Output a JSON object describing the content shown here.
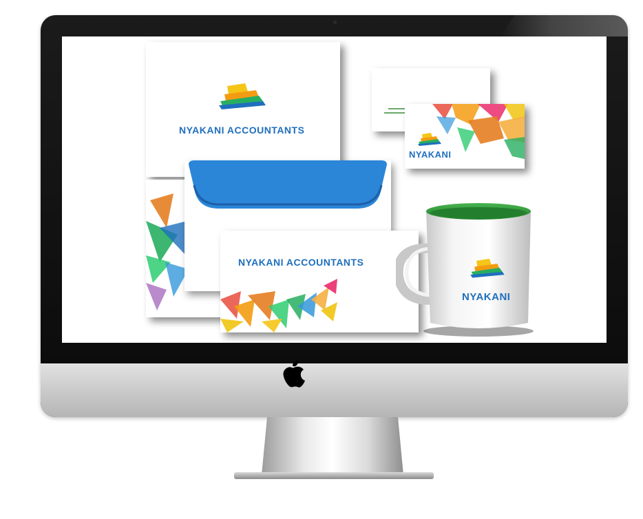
{
  "device": {
    "type": "imac-monitor",
    "logo_icon": "apple-logo-icon"
  },
  "mockup": {
    "letterhead": {
      "company": "NYAKANI  ACCOUNTANTS"
    },
    "business_card": {
      "company": "NYAKANI"
    },
    "envelope": {
      "company": "NYAKANI  ACCOUNTANTS"
    },
    "mug": {
      "company": "NYAKANI"
    }
  },
  "colors": {
    "brand_blue": "#1f6fbd",
    "envelope_flap": "#2b86d8",
    "mug_inner": "#2e9a38"
  }
}
